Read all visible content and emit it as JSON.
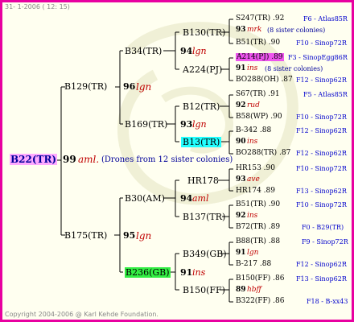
{
  "header": "31-  1-2006 ( 12: 15)",
  "footer": "Copyright 2004-2006 @ Karl Kehde Foundation.",
  "root": {
    "name": "B22(TR)",
    "year": "99",
    "breed": "aml.",
    "note": "(Drones from 12 sister colonies)"
  },
  "gen1": [
    {
      "name": "B129(TR)",
      "year": "96",
      "breed": "lgn"
    },
    {
      "name": "B175(TR)",
      "year": "95",
      "breed": "lgn"
    }
  ],
  "gen2": [
    {
      "name": "B34(TR)",
      "year": "94",
      "breed": "lgn"
    },
    {
      "name": "B169(TR)",
      "year": "93",
      "breed": "lgn"
    },
    {
      "name": "B30(AM)",
      "year": "94",
      "breed": "aml"
    },
    {
      "name": "B236(GB)",
      "year": "91",
      "breed": "ins"
    }
  ],
  "gen3": [
    {
      "name": "B130(TR)"
    },
    {
      "name": "A224(PJ)"
    },
    {
      "name": "B12(TR)"
    },
    {
      "name": "B13(TR)"
    },
    {
      "name": "HR178"
    },
    {
      "name": "B137(TR)"
    },
    {
      "name": "B349(GB)"
    },
    {
      "name": "B150(FF)"
    }
  ],
  "gen4": [
    {
      "queen": "S247(TR) .92",
      "mid_year": "93",
      "mid_breed": "mrk",
      "mid_note": "(8 sister colonies)",
      "drone": "B51(TR) .90",
      "q_ref": "F6 - Atlas85R",
      "d_ref": "F10 - Sinop72R"
    },
    {
      "queen": "A214(PJ) .89",
      "mid_year": "91",
      "mid_breed": "ins",
      "mid_note": "(8 sister colonies)",
      "drone": "BO288(OH) .87",
      "q_ref": "F3 - SinopEgg86R",
      "d_ref": "F12 - Sinop62R"
    },
    {
      "queen": "S67(TR) .91",
      "mid_year": "92",
      "mid_breed": "rud",
      "mid_note": "",
      "drone": "B58(WP) .90",
      "q_ref": "F5 - Atlas85R",
      "d_ref": "F10 - Sinop72R"
    },
    {
      "queen": "B-342 .88",
      "mid_year": "90",
      "mid_breed": "ins",
      "mid_note": "",
      "drone": "BO288(TR) .87",
      "q_ref": "F12 - Sinop62R",
      "d_ref": "F12 - Sinop62R"
    },
    {
      "queen": "HR153 .90",
      "mid_year": "93",
      "mid_breed": "ave",
      "mid_note": "",
      "drone": "HR174 .89",
      "q_ref": "F10 - Sinop72R",
      "d_ref": "F13 - Sinop62R"
    },
    {
      "queen": "B51(TR) .90",
      "mid_year": "92",
      "mid_breed": "ins",
      "mid_note": "",
      "drone": "B72(TR) .89",
      "q_ref": "F10 - Sinop72R",
      "d_ref": "F0 - B29(TR)"
    },
    {
      "queen": "B88(TR) .88",
      "mid_year": "91",
      "mid_breed": "lgn",
      "mid_note": "",
      "drone": "B-217 .88",
      "q_ref": "F9 - Sinop72R",
      "d_ref": "F12 - Sinop62R"
    },
    {
      "queen": "B150(FF) .86",
      "mid_year": "89",
      "mid_breed": "hbff",
      "mid_note": "",
      "drone": "B322(FF) .86",
      "q_ref": "F13 - Sinop62R",
      "d_ref": "F18 - B-xx43"
    }
  ],
  "colors": {
    "border": "#e800a0",
    "root_highlight": "#ffaaff",
    "green_highlight": "#33ee44",
    "cyan_highlight": "#22ffff",
    "magenta_highlight": "#ee55ee",
    "ref_blue": "#0000cc",
    "breed_red": "#c00000"
  }
}
